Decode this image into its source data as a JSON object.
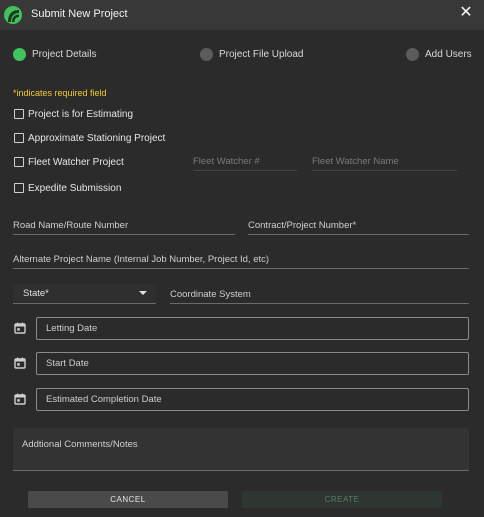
{
  "header": {
    "title": "Submit New Project",
    "close": "✕"
  },
  "steps": [
    {
      "label": "Project Details",
      "active": true
    },
    {
      "label": "Project File Upload",
      "active": false
    },
    {
      "label": "Add Users",
      "active": false
    }
  ],
  "required_note": "*indicates required field",
  "checkboxes": {
    "estimating": "Project is for Estimating",
    "stationing": "Approximate Stationing Project",
    "fleet_watcher": "Fleet Watcher Project",
    "expedite": "Expedite Submission"
  },
  "fields": {
    "fleet_watcher_number": "Fleet Watcher #",
    "fleet_watcher_name": "Fleet Watcher Name",
    "road_name": "Road Name/Route Number",
    "contract_number": "Contract/Project Number*",
    "alternate_name": "Alternate Project Name (Internal Job Number, Project Id, etc)",
    "state": "State*",
    "coordinate_system": "Coordinate System",
    "letting_date": "Letting Date",
    "start_date": "Start Date",
    "completion_date": "Estimated Completion Date",
    "comments": "Addtional Comments/Notes"
  },
  "buttons": {
    "cancel": "CANCEL",
    "create": "CREATE"
  },
  "colors": {
    "accent": "#3fc45d",
    "required": "#f0cc2c",
    "background": "#2b2b2b"
  }
}
